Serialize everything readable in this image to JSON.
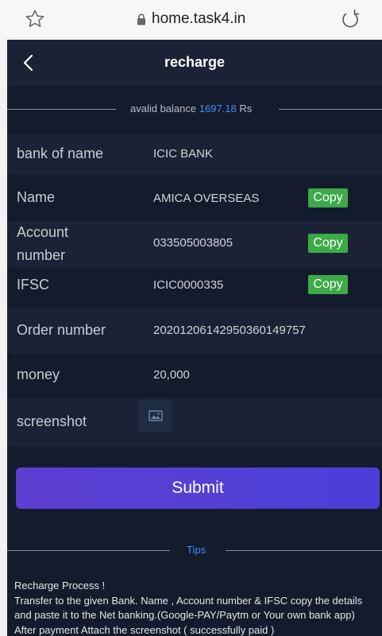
{
  "browser": {
    "url": "home.task4.in"
  },
  "header": {
    "title": "recharge"
  },
  "balance": {
    "prefix": "avalid balance",
    "amount": "1697.18",
    "unit": "Rs"
  },
  "fields": {
    "bank_label": "bank of name",
    "bank_value": "ICIC BANK",
    "name_label": "Name",
    "name_value": "AMICA OVERSEAS",
    "account_label": "Account number",
    "account_value": "033505003805",
    "ifsc_label": "IFSC",
    "ifsc_value": "ICIC0000335",
    "order_label": "Order number",
    "order_value": "20201206142950360149757",
    "money_label": "money",
    "money_value": "20,000",
    "screenshot_label": "screenshot",
    "copy_label": "Copy"
  },
  "submit_label": "Submit",
  "tips": {
    "label": "Tips",
    "heading": "Recharge Process !",
    "body": "Transfer to the given Bank. Name , Account number & IFSC copy the details and paste it to the Net banking.(Google-PAY/Paytm or Your own bank app) After payment Attach the screenshot ( successfully paid )"
  },
  "colors": {
    "accent": "#3e8bff",
    "copy_green": "#3caa48",
    "submit_purple": "#5a40d4",
    "background": "#141b2d"
  }
}
